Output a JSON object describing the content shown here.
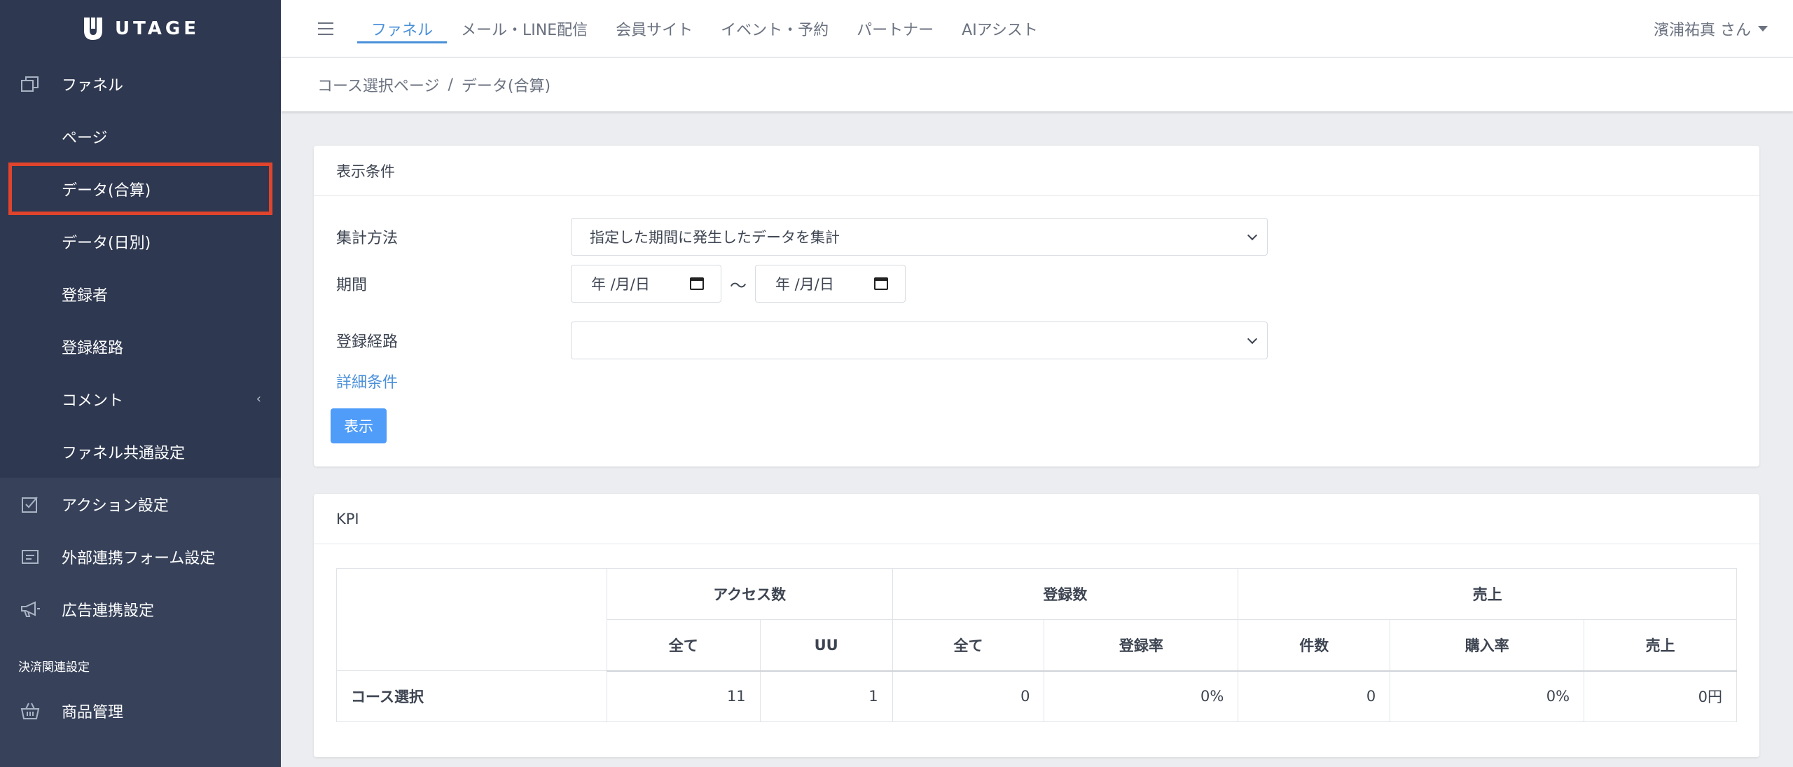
{
  "brand": {
    "name": "UTAGE"
  },
  "sidebar": {
    "items": [
      {
        "label": "ファネル",
        "icon": "copy-icon"
      },
      {
        "label": "ページ"
      },
      {
        "label": "データ(合算)"
      },
      {
        "label": "データ(日別)"
      },
      {
        "label": "登録者"
      },
      {
        "label": "登録経路"
      },
      {
        "label": "コメント",
        "chevron": "‹"
      },
      {
        "label": "ファネル共通設定"
      },
      {
        "label": "アクション設定",
        "icon": "checkbox-icon"
      },
      {
        "label": "外部連携フォーム設定",
        "icon": "form-icon"
      },
      {
        "label": "広告連携設定",
        "icon": "megaphone-icon"
      }
    ],
    "section_label": "決済関連設定",
    "product_item": {
      "label": "商品管理",
      "icon": "basket-icon"
    }
  },
  "topnav": {
    "tabs": [
      "ファネル",
      "メール・LINE配信",
      "会員サイト",
      "イベント・予約",
      "パートナー",
      "AIアシスト"
    ],
    "active_tab": "ファネル",
    "user": "濱浦祐真 さん"
  },
  "breadcrumb": {
    "parent": "コース選択ページ",
    "separator": "/",
    "current": "データ(合算)"
  },
  "conditions": {
    "title": "表示条件",
    "method_label": "集計方法",
    "method_value": "指定した期間に発生したデータを集計",
    "period_label": "期間",
    "date_placeholder": "年 /月/日",
    "tilde": "〜",
    "route_label": "登録経路",
    "route_value": "",
    "detail_link": "詳細条件",
    "show_button": "表示"
  },
  "kpi": {
    "title": "KPI",
    "groups": [
      "アクセス数",
      "登録数",
      "売上"
    ],
    "subheaders": [
      "全て",
      "UU",
      "全て",
      "登録率",
      "件数",
      "購入率",
      "売上"
    ],
    "rows": [
      {
        "label": "コース選択",
        "values": [
          "11",
          "1",
          "0",
          "0%",
          "0",
          "0%",
          "0円"
        ]
      }
    ]
  },
  "colors": {
    "sidebar": "#37425a",
    "accent": "#4a90d9",
    "button": "#4f9cf9",
    "highlight": "#e0442c"
  }
}
